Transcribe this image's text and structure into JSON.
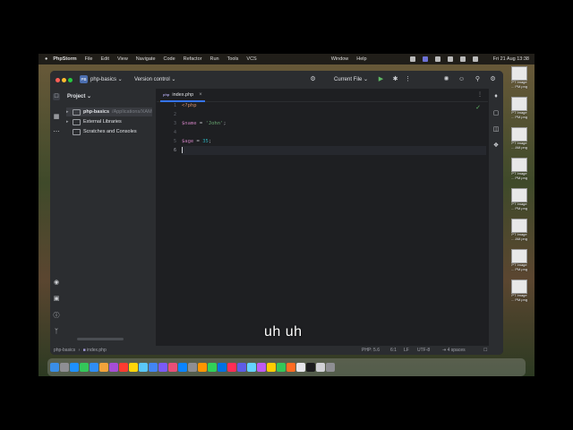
{
  "menubar": {
    "app": "PhpStorm",
    "items": [
      "File",
      "Edit",
      "View",
      "Navigate",
      "Code",
      "Refactor",
      "Run",
      "Tools",
      "VCS",
      "Window",
      "Help"
    ],
    "datetime": "Fri 21 Aug 13:38"
  },
  "titlebar": {
    "project_badge": "PB",
    "project_name": "php-basics",
    "vcs_label": "Version control",
    "run_config": "Current File"
  },
  "project_panel": {
    "header": "Project",
    "tree": [
      {
        "label": "php-basics",
        "path": "/Applications/XAM"
      },
      {
        "label": "External Libraries"
      },
      {
        "label": "Scratches and Consoles"
      }
    ]
  },
  "editor": {
    "tab_icon": "php",
    "tab_label": "index.php",
    "line_numbers": [
      "1",
      "2",
      "3",
      "4",
      "5",
      "6"
    ],
    "lines": {
      "l1": "<?php",
      "l3_var": "$name",
      "l3_op": " = ",
      "l3_str": "'John'",
      "l3_end": ";",
      "l5_var": "$age",
      "l5_op": " = ",
      "l5_num": "35",
      "l5_end": ";"
    }
  },
  "statusbar": {
    "breadcrumb_project": "php-basics",
    "breadcrumb_file": "index.php",
    "php_version": "PHP: 5.6",
    "position": "6:1",
    "line_sep": "LF",
    "encoding": "UTF-8",
    "indent": "4 spaces"
  },
  "subtitle": "uh uh",
  "desktop_files": [
    {
      "l1": "PT Image",
      "l2": "... PM.png"
    },
    {
      "l1": "PT Image",
      "l2": "... PM.png"
    },
    {
      "l1": "PT Image",
      "l2": "... AM.png"
    },
    {
      "l1": "PT Image",
      "l2": "... PM.png"
    },
    {
      "l1": "PT Image",
      "l2": "... PM.png"
    },
    {
      "l1": "PT Image",
      "l2": "... AM.png"
    },
    {
      "l1": "PT Image",
      "l2": "... PM.png"
    },
    {
      "l1": "PT Image",
      "l2": "... PM.png"
    }
  ]
}
